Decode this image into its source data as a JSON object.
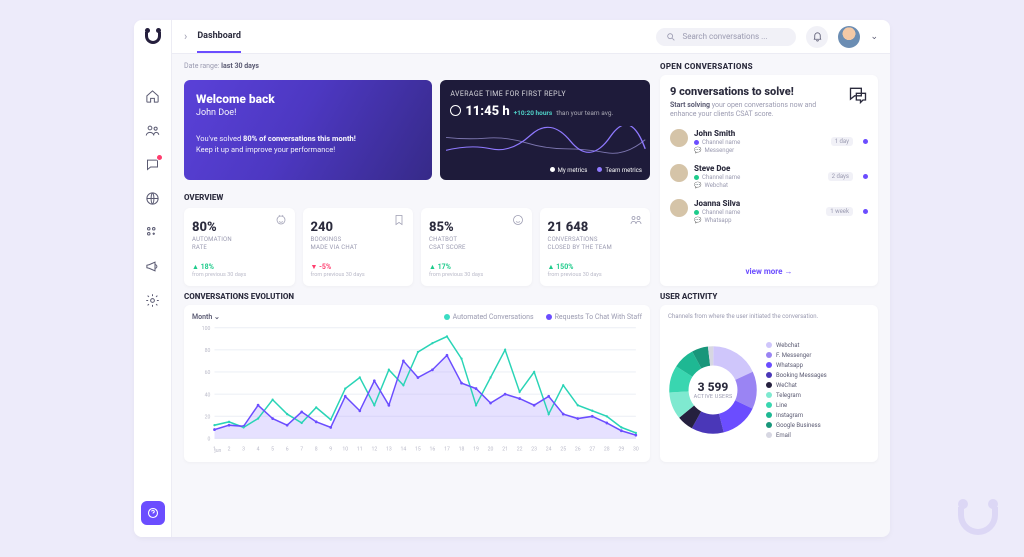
{
  "header": {
    "tab": "Dashboard",
    "search_placeholder": "Search conversations ..."
  },
  "date_range": {
    "prefix": "Date range:",
    "value": "last 30 days"
  },
  "welcome": {
    "heading": "Welcome back",
    "name": "John Doe!",
    "line1_a": "You've solved ",
    "line1_b": "80% of conversations this month!",
    "line2": "Keep it up and improve your performance!"
  },
  "avg": {
    "title": "AVERAGE TIME FOR FIRST REPLY",
    "time": "11:45 h",
    "delta": "+10:20 hours",
    "delta_sub": "than your team avg.",
    "legend_a": "My metrics",
    "legend_b": "Team metrics"
  },
  "open": {
    "hdr": "OPEN CONVERSATIONS",
    "title": "9 conversations to solve!",
    "sub_a": "Start solving",
    "sub_b": " your open conversations now and enhance your clients CSAT score.",
    "items": [
      {
        "name": "John Smith",
        "channel_label": "Channel name",
        "source": "Messenger",
        "age": "1 day",
        "dot": "#6b4dff"
      },
      {
        "name": "Steve Doe",
        "channel_label": "Channel name",
        "source": "Webchat",
        "age": "2 days",
        "dot": "#1ecb8b"
      },
      {
        "name": "Joanna Silva",
        "channel_label": "Channel name",
        "source": "Whatsapp",
        "age": "1 week",
        "dot": "#1ecb8b"
      }
    ],
    "view_more": "view more"
  },
  "overview": {
    "hdr": "OVERVIEW",
    "cards": [
      {
        "value": "80%",
        "label1": "AUTOMATION",
        "label2": "RATE",
        "change": "18%",
        "dir": "up",
        "sub": "from previous 30 days"
      },
      {
        "value": "240",
        "label1": "BOOKINGS",
        "label2": "MADE VIA CHAT",
        "change": "-5%",
        "dir": "down",
        "sub": "from previous 30 days"
      },
      {
        "value": "85%",
        "label1": "CHATBOT",
        "label2": "CSAT SCORE",
        "change": "17%",
        "dir": "up",
        "sub": "from previous 30 days"
      },
      {
        "value": "21 648",
        "label1": "Conversations",
        "label2": "closed by the team",
        "change": "150%",
        "dir": "up",
        "sub": "from previous 30 days"
      }
    ]
  },
  "evolution": {
    "hdr": "CONVERSATIONS EVOLUTION",
    "selector": "Month",
    "legend_a": "Automated Conversations",
    "legend_b": "Requests To Chat With Staff",
    "xlabel": "jun"
  },
  "activity": {
    "hdr": "USER ACTIVITY",
    "sub": "Channels from where the user initiated the conversation.",
    "center_value": "3 599",
    "center_label": "ACTIVE USERS",
    "channels": [
      {
        "name": "Webchat",
        "color": "#cfc6fb"
      },
      {
        "name": "F. Messenger",
        "color": "#9a84f3"
      },
      {
        "name": "Whatsapp",
        "color": "#6b4dff"
      },
      {
        "name": "Booking Messages",
        "color": "#4a37b8"
      },
      {
        "name": "WeChat",
        "color": "#25203e"
      },
      {
        "name": "Telegram",
        "color": "#7fe9d0"
      },
      {
        "name": "Line",
        "color": "#39d6b0"
      },
      {
        "name": "Instagram",
        "color": "#1eb893"
      },
      {
        "name": "Google Business",
        "color": "#18967a"
      },
      {
        "name": "Email",
        "color": "#d7d7e2"
      }
    ]
  },
  "chart_data": [
    {
      "type": "line",
      "title": "Average time for first reply (sparkline)",
      "x": [
        0,
        1,
        2,
        3,
        4,
        5,
        6,
        7,
        8,
        9
      ],
      "series": [
        {
          "name": "My metrics",
          "values": [
            6,
            5.5,
            5.7,
            5.2,
            4.8,
            4.3,
            4.6,
            4.1,
            3.6,
            5.5
          ]
        },
        {
          "name": "Team metrics",
          "values": [
            4,
            4.8,
            4.2,
            5.8,
            5.5,
            6.1,
            5.4,
            5.9,
            5.2,
            4.4
          ]
        }
      ]
    },
    {
      "type": "area",
      "title": "Conversations Evolution",
      "xlabel": "jun",
      "ylabel": "",
      "x_ticks": [
        1,
        2,
        3,
        4,
        5,
        6,
        7,
        8,
        9,
        10,
        11,
        12,
        13,
        14,
        15,
        16,
        17,
        18,
        19,
        20,
        21,
        22,
        23,
        24,
        25,
        26,
        27,
        28,
        29,
        30
      ],
      "y_ticks": [
        0,
        20,
        40,
        60,
        80,
        100
      ],
      "ylim": [
        0,
        100
      ],
      "series": [
        {
          "name": "Automated Conversations",
          "values": [
            12,
            15,
            10,
            18,
            35,
            22,
            14,
            28,
            17,
            45,
            55,
            30,
            62,
            48,
            78,
            86,
            92,
            72,
            30,
            55,
            80,
            42,
            60,
            22,
            48,
            30,
            25,
            20,
            10,
            5
          ]
        },
        {
          "name": "Requests To Chat With Staff",
          "values": [
            8,
            12,
            11,
            30,
            18,
            12,
            24,
            15,
            10,
            38,
            25,
            52,
            30,
            70,
            55,
            62,
            75,
            50,
            45,
            32,
            40,
            36,
            30,
            38,
            22,
            18,
            20,
            14,
            7,
            3
          ]
        }
      ]
    },
    {
      "type": "pie",
      "title": "User Activity — channel share",
      "categories": [
        "Webchat",
        "F. Messenger",
        "Whatsapp",
        "Booking Messages",
        "WeChat",
        "Telegram",
        "Line",
        "Instagram",
        "Google Business",
        "Email"
      ],
      "values": [
        18,
        14,
        14,
        12,
        6,
        10,
        10,
        8,
        6,
        2
      ],
      "total_label": "3 599 ACTIVE USERS"
    }
  ]
}
